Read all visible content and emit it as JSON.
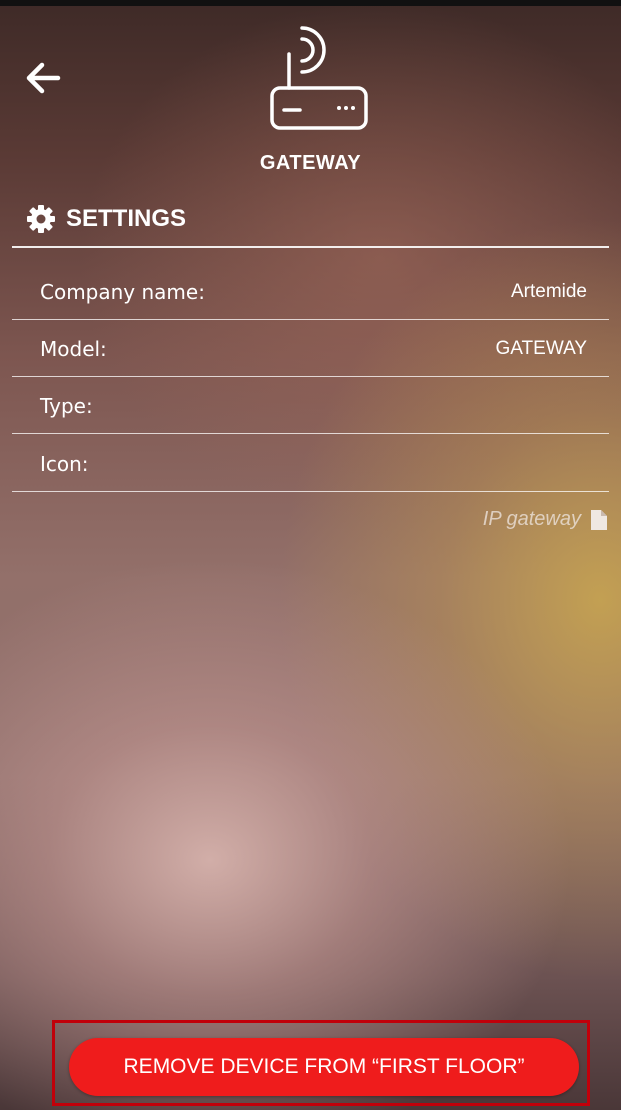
{
  "header": {
    "device_title": "GATEWAY",
    "back_icon": "arrow-left-icon",
    "device_icon": "wifi-router-icon"
  },
  "settings": {
    "title": "SETTINGS",
    "icon": "gear-icon",
    "rows": [
      {
        "label": "Company name:",
        "value": "Artemide"
      },
      {
        "label": "Model:",
        "value": "GATEWAY"
      },
      {
        "label": "Type:",
        "value": ""
      },
      {
        "label": "Icon:",
        "value": ""
      }
    ],
    "document_link": {
      "label": "IP gateway",
      "icon": "document-icon"
    }
  },
  "actions": {
    "remove_label": "REMOVE DEVICE FROM “FIRST FLOOR”",
    "remove_color": "#ef1c1c"
  }
}
